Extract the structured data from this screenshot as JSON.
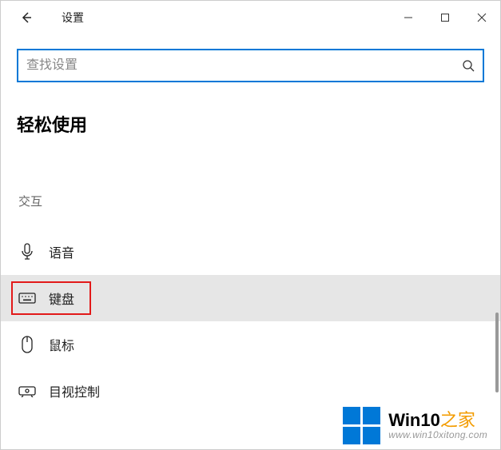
{
  "window": {
    "title": "设置"
  },
  "search": {
    "placeholder": "查找设置"
  },
  "page": {
    "title": "轻松使用"
  },
  "section": {
    "label": "交互"
  },
  "items": [
    {
      "label": "语音",
      "icon": "microphone-icon",
      "selected": false
    },
    {
      "label": "键盘",
      "icon": "keyboard-icon",
      "selected": true
    },
    {
      "label": "鼠标",
      "icon": "mouse-icon",
      "selected": false
    },
    {
      "label": "目视控制",
      "icon": "eye-control-icon",
      "selected": false
    }
  ],
  "watermark": {
    "brand_prefix": "Win10",
    "brand_suffix": "之家",
    "url": "www.win10xitong.com"
  }
}
